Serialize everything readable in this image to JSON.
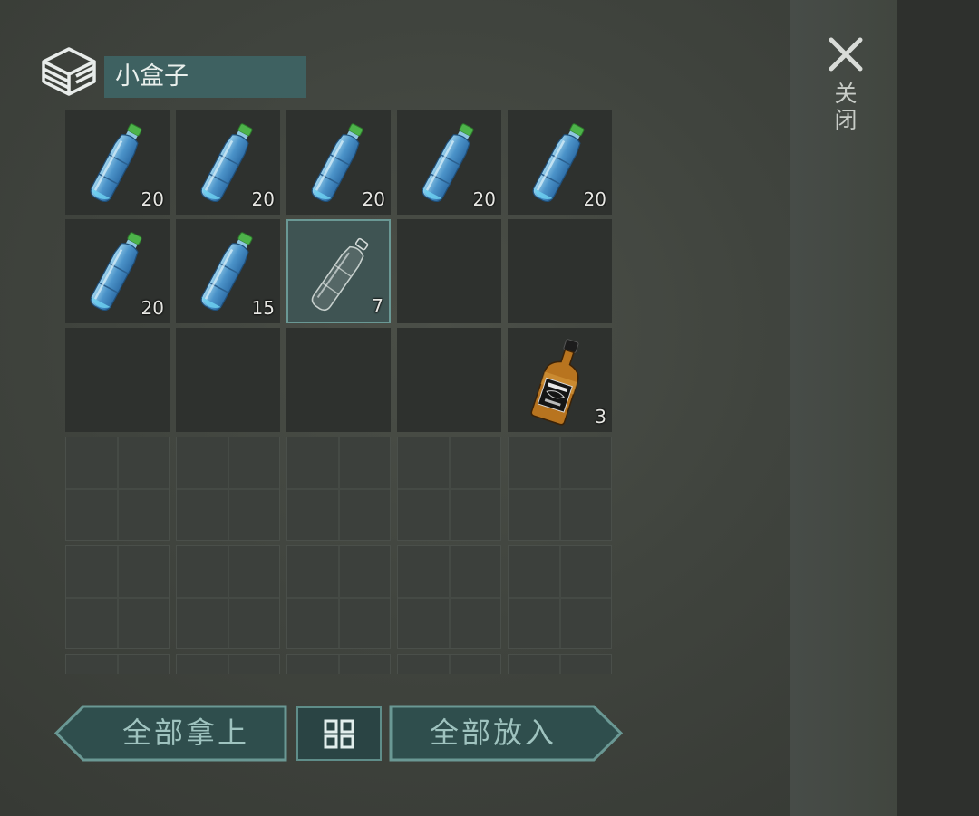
{
  "container": {
    "title": "小盒子",
    "icon": "box-icon"
  },
  "close": {
    "icon": "close-icon",
    "label": "关闭"
  },
  "slots": [
    {
      "item": "water-bottle",
      "count": "20"
    },
    {
      "item": "water-bottle",
      "count": "20"
    },
    {
      "item": "water-bottle",
      "count": "20"
    },
    {
      "item": "water-bottle",
      "count": "20"
    },
    {
      "item": "water-bottle",
      "count": "20"
    },
    {
      "item": "water-bottle",
      "count": "20"
    },
    {
      "item": "water-bottle",
      "count": "15"
    },
    {
      "item": "empty-bottle",
      "count": "7",
      "selected": true
    },
    {
      "item": null,
      "count": ""
    },
    {
      "item": null,
      "count": ""
    },
    {
      "item": null,
      "count": ""
    },
    {
      "item": null,
      "count": ""
    },
    {
      "item": null,
      "count": ""
    },
    {
      "item": null,
      "count": ""
    },
    {
      "item": "whiskey-bottle",
      "count": "3"
    }
  ],
  "buttons": {
    "take_all": "全部拿上",
    "sort_icon": "sort-grid-icon",
    "put_all": "全部放入"
  },
  "colors": {
    "accent": "#3e6161",
    "button_fill": "#2f4e4d",
    "button_border": "#6a9894",
    "button_text": "#9fc3bf"
  }
}
